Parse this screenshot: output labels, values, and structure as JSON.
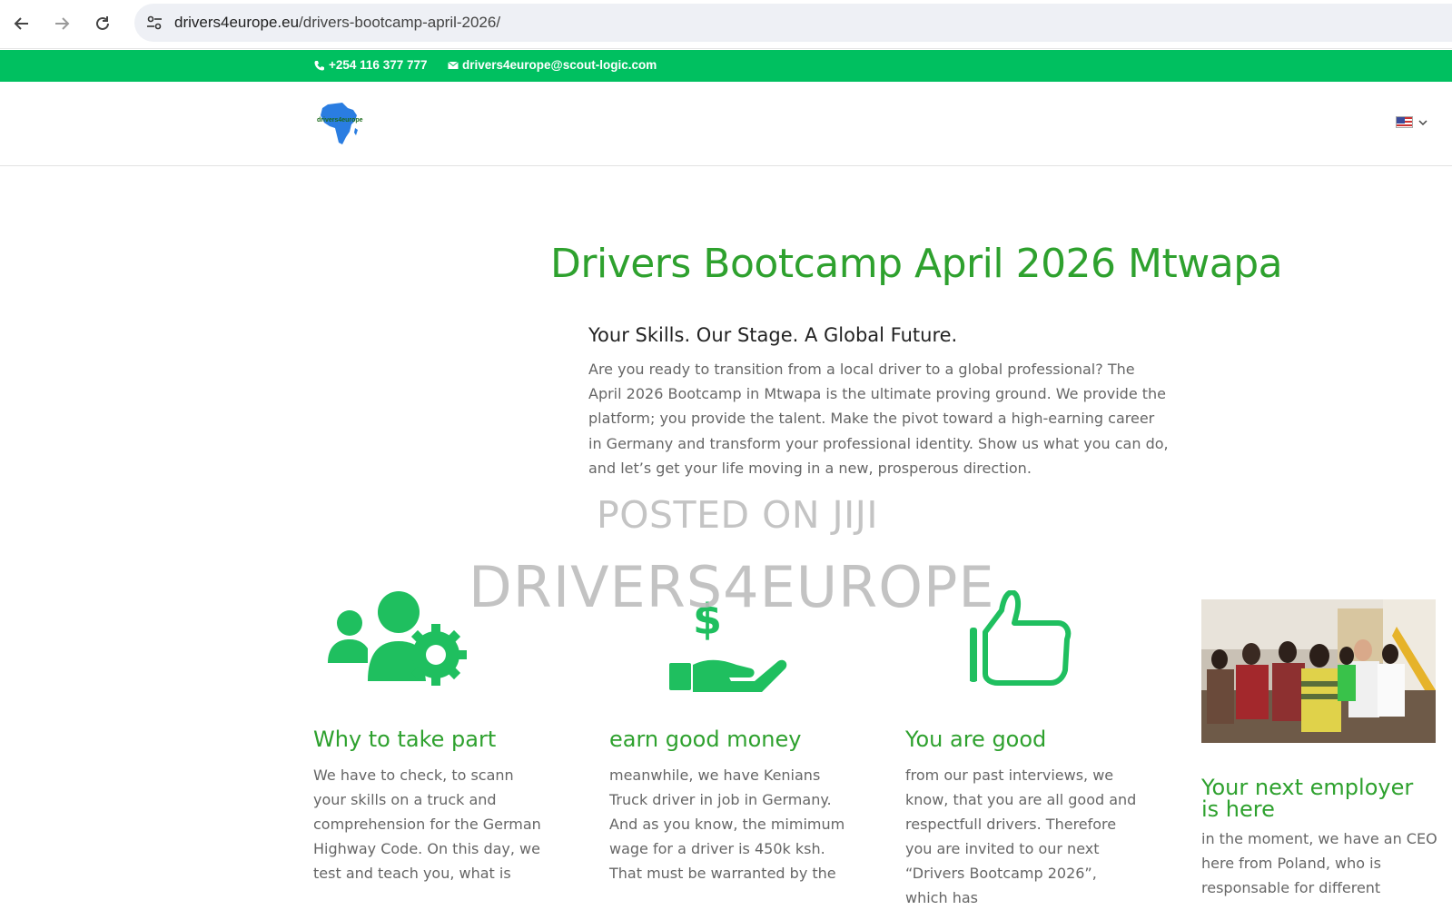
{
  "browser": {
    "url_domain": "drivers4europe.eu",
    "url_path": "/drivers-bootcamp-april-2026/"
  },
  "topbar": {
    "phone": "+254 116 377 777",
    "email": "drivers4europe@scout-logic.com"
  },
  "header": {
    "logo_text": "drivers4europe",
    "language": "English (US)"
  },
  "page": {
    "title": "Drivers Bootcamp April 2026 Mtwapa",
    "tagline": "Your Skills. Our Stage. A Global Future.",
    "intro": "Are you ready to transition from a local driver to a global professional? The April 2026 Bootcamp in Mtwapa is the ultimate proving ground. We provide the platform; you provide the talent. Make the pivot toward a high-earning career in Germany and transform your professional identity. Show us what you can do, and let’s get your life moving in a new, prosperous direction.",
    "watermark_top": "POSTED ON JIJI",
    "watermark_main": "DRIVERS4EUROPE"
  },
  "columns": [
    {
      "heading": "Why to take part",
      "text": "We have to check, to scann your skills on a truck and comprehension for the German Highway Code. On this day, we test and teach you, what is",
      "icon": "team-settings-icon"
    },
    {
      "heading": "earn good money",
      "text": "meanwhile, we have Kenians Truck driver in job in Germany. And as you know, the mimimum wage for a driver is 450k ksh. That must be warranted by the",
      "icon": "money-hand-icon"
    },
    {
      "heading": "You are good",
      "text": "from our past interviews, we know, that you are all good and respectfull drivers. Therefore you are invited to our next “Drivers Bootcamp 2026”, which has",
      "icon": "thumbs-up-icon"
    },
    {
      "heading": "Your next employer is here",
      "text": "in the moment, we have an CEO here from Poland, who is responsable for different",
      "icon": "group-photo"
    }
  ],
  "colors": {
    "brand_green": "#00c060",
    "heading_green": "#2ea12e",
    "body_text": "#666666"
  }
}
